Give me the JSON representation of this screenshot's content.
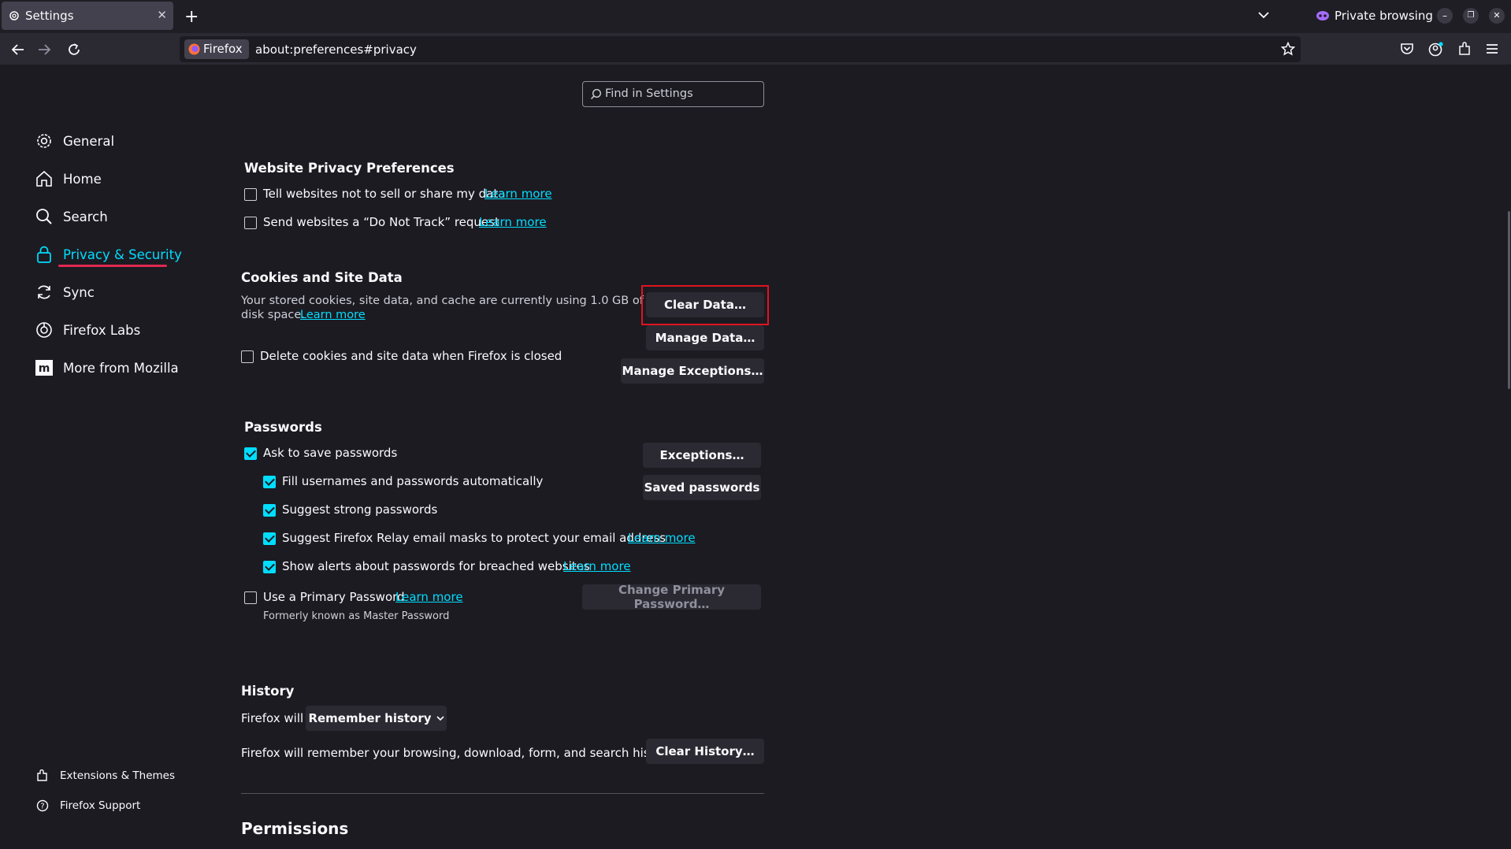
{
  "browser": {
    "tab_title": "Settings",
    "identity_label": "Firefox",
    "url": "about:preferences#privacy",
    "private_label": "Private browsing",
    "icons": [
      "gear-icon",
      "close-icon",
      "plus-icon",
      "chevron-down-icon",
      "private-mask-icon",
      "minimize-icon",
      "restore-icon",
      "back-icon",
      "forward-icon",
      "reload-icon",
      "star-icon",
      "pocket-icon",
      "account-icon",
      "extensions-icon",
      "menu-icon"
    ]
  },
  "search": {
    "placeholder": "Find in Settings"
  },
  "sidebar": {
    "items": [
      {
        "label": "General",
        "icon": "gear-icon"
      },
      {
        "label": "Home",
        "icon": "home-icon"
      },
      {
        "label": "Search",
        "icon": "search-icon"
      },
      {
        "label": "Privacy & Security",
        "icon": "lock-icon",
        "selected": true
      },
      {
        "label": "Sync",
        "icon": "sync-icon"
      },
      {
        "label": "Firefox Labs",
        "icon": "labs-icon"
      },
      {
        "label": "More from Mozilla",
        "icon": "mozilla-icon"
      }
    ],
    "footer": [
      {
        "label": "Extensions & Themes",
        "icon": "puzzle-icon"
      },
      {
        "label": "Firefox Support",
        "icon": "help-icon"
      }
    ]
  },
  "website_privacy": {
    "heading": "Website Privacy Preferences",
    "options": [
      {
        "label": "Tell websites not to sell or share my data",
        "link": "Learn more",
        "checked": false
      },
      {
        "label": "Send websites a “Do Not Track” request",
        "link": "Learn more",
        "checked": false
      }
    ]
  },
  "cookies": {
    "heading": "Cookies and Site Data",
    "desc_line1": "Your stored cookies, site data, and cache are currently using 1.0 GB of",
    "desc_line2": "disk space.",
    "learn_more": "Learn more",
    "delete_label": "Delete cookies and site data when Firefox is closed",
    "delete_checked": false,
    "clear_button": "Clear Data…",
    "manage_button": "Manage Data…",
    "exceptions_button": "Manage Exceptions…"
  },
  "passwords": {
    "heading": "Passwords",
    "ask_label": "Ask to save passwords",
    "ask_checked": true,
    "sub": [
      {
        "label": "Fill usernames and passwords automatically",
        "checked": true,
        "link": ""
      },
      {
        "label": "Suggest strong passwords",
        "checked": true,
        "link": ""
      },
      {
        "label": "Suggest Firefox Relay email masks to protect your email address",
        "checked": true,
        "link": "Learn more"
      },
      {
        "label": "Show alerts about passwords for breached websites",
        "checked": true,
        "link": "Learn more"
      }
    ],
    "primary_label": "Use a Primary Password",
    "primary_link": "Learn more",
    "primary_checked": false,
    "formerly": "Formerly known as Master Password",
    "exceptions_button": "Exceptions…",
    "saved_button": "Saved passwords",
    "change_primary_button": "Change Primary Password…"
  },
  "history": {
    "heading": "History",
    "firefox_will": "Firefox will",
    "mode": "Remember history",
    "desc": "Firefox will remember your browsing, download, form, and search history.",
    "clear_button": "Clear History…"
  },
  "permissions": {
    "heading": "Permissions"
  },
  "colors": {
    "accent": "#00ddff",
    "highlight_box": "#e0141e",
    "selected_underline": "#e22850",
    "background": "#1c1b22"
  }
}
